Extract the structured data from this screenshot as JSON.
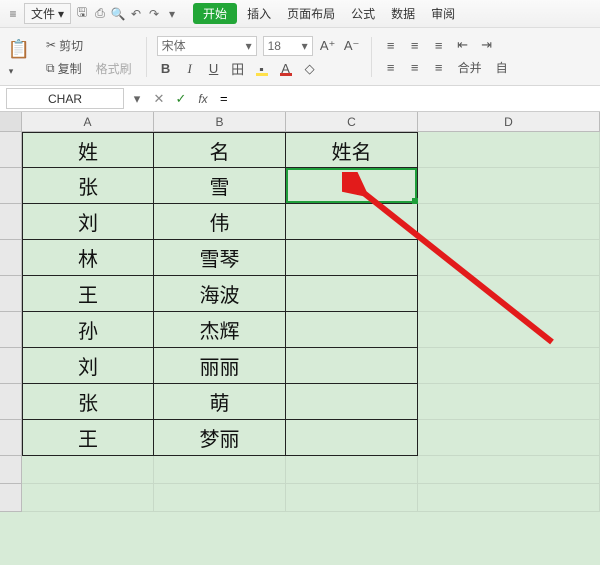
{
  "menu": {
    "hamburger": "≡",
    "file": "文件",
    "start": "开始",
    "insert": "插入",
    "page_layout": "页面布局",
    "formulas": "公式",
    "data": "数据",
    "review": "审阅"
  },
  "ribbon": {
    "cut": "剪切",
    "copy": "复制",
    "format_painter": "格式刷",
    "font_name": "宋体",
    "font_size": "18",
    "merge": "合并",
    "auto": "自"
  },
  "formula_bar": {
    "name_box": "CHAR",
    "formula": "="
  },
  "columns": [
    "A",
    "B",
    "C",
    "D"
  ],
  "rows": [
    "",
    "",
    "",
    "",
    "",
    "",
    "",
    "",
    "",
    "",
    ""
  ],
  "sheet": {
    "header": {
      "a": "姓",
      "b": "名",
      "c": "姓名"
    },
    "data": [
      {
        "a": "张",
        "b": "雪"
      },
      {
        "a": "刘",
        "b": "伟"
      },
      {
        "a": "林",
        "b": "雪琴"
      },
      {
        "a": "王",
        "b": "海波"
      },
      {
        "a": "孙",
        "b": "杰辉"
      },
      {
        "a": "刘",
        "b": "丽丽"
      },
      {
        "a": "张",
        "b": "萌"
      },
      {
        "a": "王",
        "b": "梦丽"
      }
    ],
    "active_cell_value": "="
  },
  "icons": {
    "scissors": "✂",
    "copy": "⧉",
    "brush": "✎",
    "dropdown": "▾",
    "cancel": "✕",
    "confirm": "✓",
    "fx": "fx",
    "save": "💾",
    "undo": "↶",
    "redo": "↷",
    "print": "⎙"
  }
}
